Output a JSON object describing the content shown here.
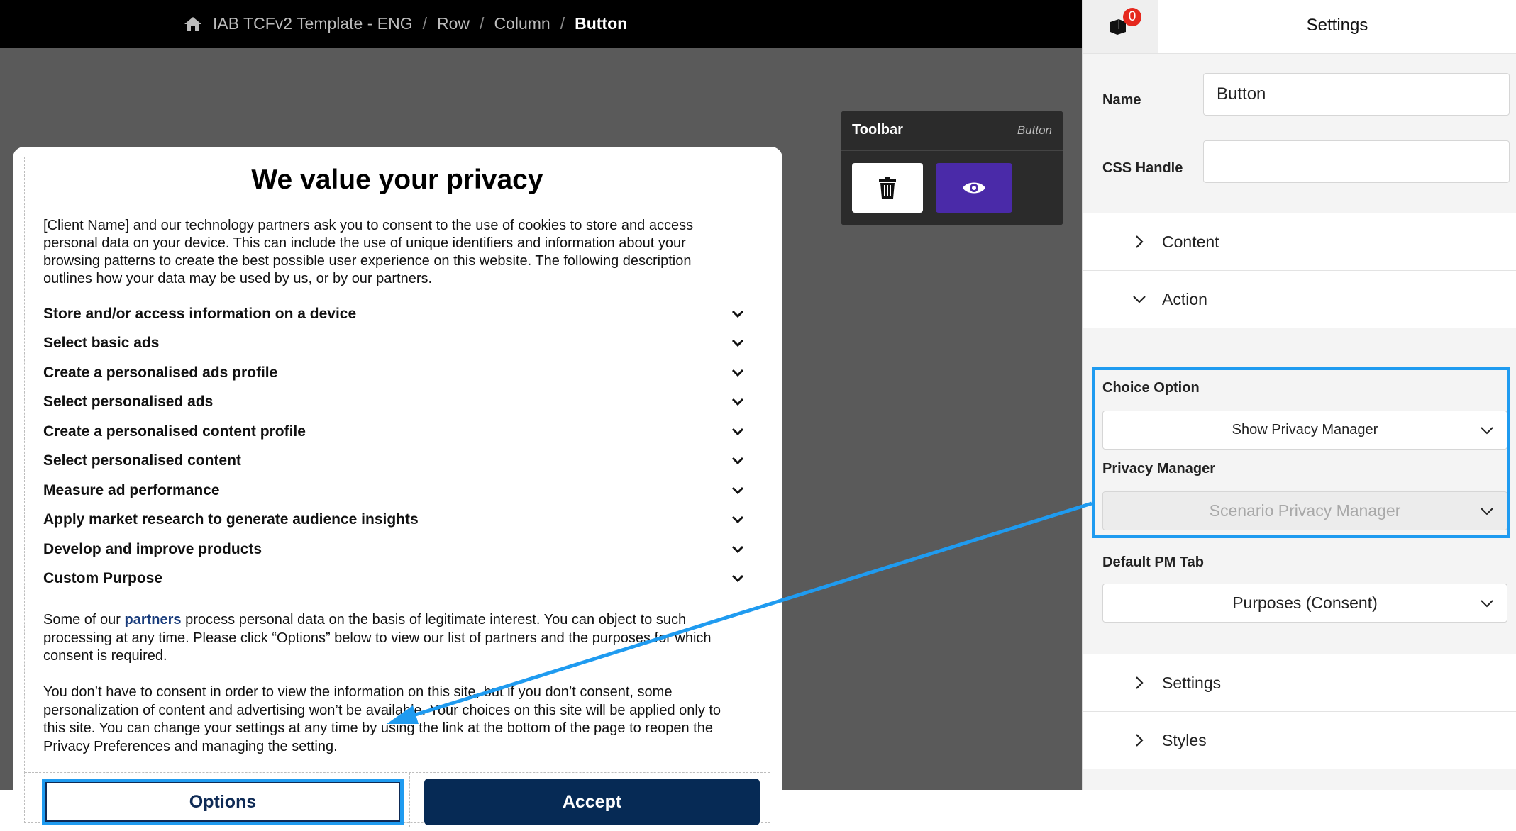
{
  "breadcrumb": {
    "items": [
      "IAB TCFv2 Template - ENG",
      "Row",
      "Column"
    ],
    "current": "Button",
    "separator": "/"
  },
  "message": {
    "title": "We value your privacy",
    "intro": "[Client Name] and our technology partners ask you to consent to the use of cookies to store and access personal data on your device. This can include the use of unique identifiers and information about your browsing patterns to create the best possible user experience on this website. The following description outlines how your data may be used by us, or by our partners.",
    "purposes": [
      "Store and/or access information on a device",
      "Select basic ads",
      "Create a personalised ads profile",
      "Select personalised ads",
      "Create a personalised content profile",
      "Select personalised content",
      "Measure ad performance",
      "Apply market research to generate audience insights",
      "Develop and improve products",
      "Custom Purpose"
    ],
    "para2_before": "Some of our ",
    "para2_link": "partners",
    "para2_after": " process personal data on the basis of legitimate interest. You can object to such processing at any time. Please click “Options” below to view our list of partners and the purposes for which consent is required.",
    "para3": "You don’t have to consent in order to view the information on this site, but if you don’t consent, some personalization of content and advertising won’t be available. Your choices on this site will be applied only to this site. You can change your settings at any time by using the link at the bottom of the page to reopen the Privacy Preferences and managing the setting.",
    "options_label": "Options",
    "accept_label": "Accept"
  },
  "toolbar": {
    "title": "Toolbar",
    "subtitle": "Button"
  },
  "panel": {
    "notification_count": "0",
    "title": "Settings",
    "name_label": "Name",
    "name_value": "Button",
    "css_label": "CSS Handle",
    "css_value": "",
    "sections": {
      "content": "Content",
      "action": "Action",
      "settings": "Settings",
      "styles": "Styles"
    },
    "choice_option_label": "Choice Option",
    "choice_option_value": "Show Privacy Manager",
    "privacy_manager_label": "Privacy Manager",
    "privacy_manager_value": "Scenario Privacy Manager",
    "default_pm_tab_label": "Default PM Tab",
    "default_pm_tab_value": "Purposes (Consent)"
  },
  "colors": {
    "accent_highlight": "#1f9bf0",
    "accept_button": "#062a55",
    "preview_button": "#4a2aa8",
    "badge": "#e5281e"
  }
}
